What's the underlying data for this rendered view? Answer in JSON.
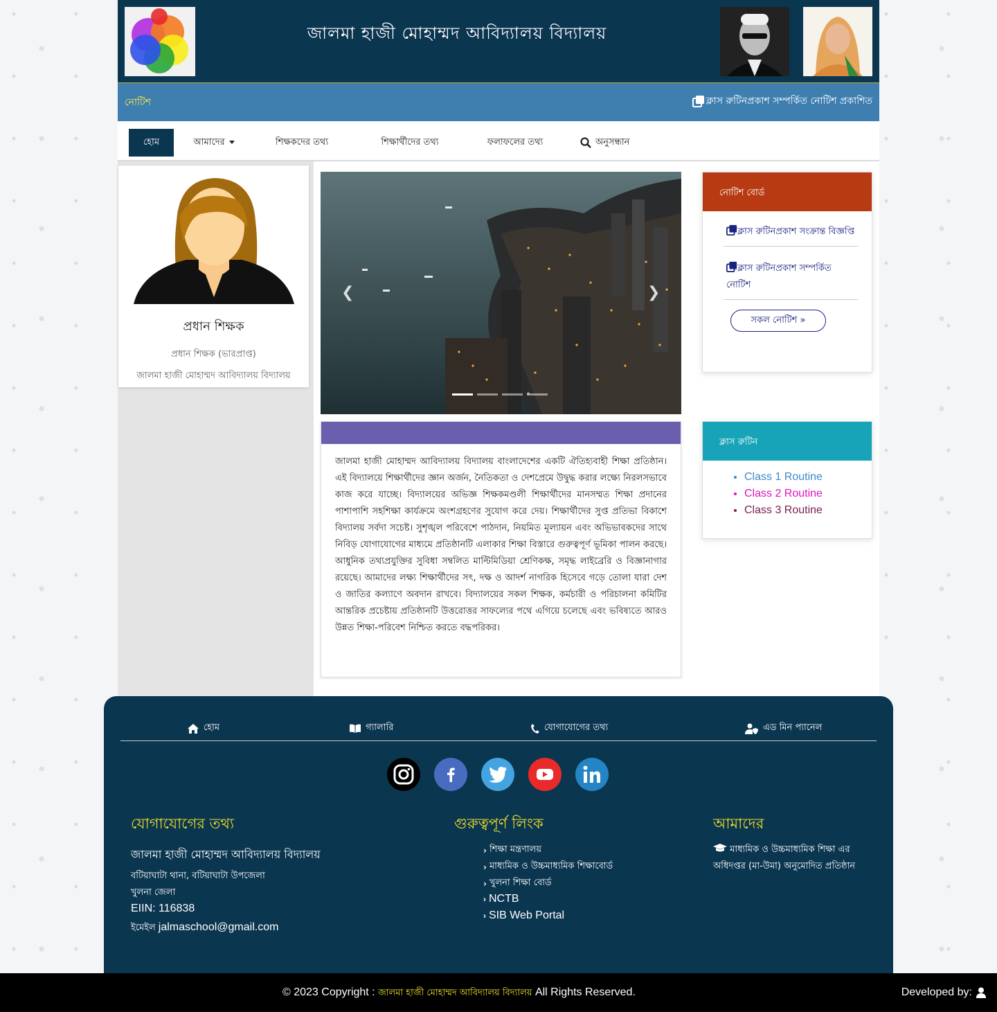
{
  "header": {
    "title": "জালমা হাজী মোহাম্মদ আবিদ্যালয় বিদ্যালয়"
  },
  "notice_bar": {
    "label": "নোটিশ",
    "ticker": "ক্লাস রুটিনপ্রকাশ সম্পর্কিত নোটিশ প্রকাশিত"
  },
  "nav": {
    "home": "হোম",
    "about": "আমাদের",
    "teachers": "শিক্ষকদের তথ্য",
    "students": "শিক্ষার্থীদের তথ্য",
    "result": "ফলাফলের তথ্য",
    "search": "অনুসন্ধান"
  },
  "profile": {
    "name": "প্রধান শিক্ষক",
    "role": "প্রধান শিক্ষক (ভারপ্রাপ্ত)",
    "school": "জালমা হাজী মোহাম্মদ আবিদ্যালয় বিদ্যালয়"
  },
  "about": {
    "text": "জালমা হাজী মোহাম্মদ আবিদ্যালয় বিদ্যালয় বাংলাদেশের একটি ঐতিহ্যবাহী শিক্ষা প্রতিষ্ঠান। এই বিদ্যালয়ে শিক্ষার্থীদের জ্ঞান অর্জন, নৈতিকতা ও দেশপ্রেমে উদ্বুদ্ধ করার লক্ষ্যে নিরলসভাবে কাজ করে যাচ্ছে। বিদ্যালয়ের অভিজ্ঞ শিক্ষকমণ্ডলী শিক্ষার্থীদের মানসম্মত শিক্ষা প্রদানের পাশাপাশি সহশিক্ষা কার্যক্রমে অংশগ্রহণের সুযোগ করে দেয়। শিক্ষার্থীদের সুপ্ত প্রতিভা বিকাশে বিদ্যালয় সর্বদা সচেষ্ট। সুশৃঙ্খল পরিবেশে পাঠদান, নিয়মিত মূল্যায়ন এবং অভিভাবকদের সাথে নিবিড় যোগাযোগের মাধ্যমে প্রতিষ্ঠানটি এলাকার শিক্ষা বিস্তারে গুরুত্বপূর্ণ ভূমিকা পালন করছে। আধুনিক তথ্যপ্রযুক্তির সুবিধা সম্বলিত মাল্টিমিডিয়া শ্রেণিকক্ষ, সমৃদ্ধ লাইব্রেরি ও বিজ্ঞানাগার রয়েছে। আমাদের লক্ষ্য শিক্ষার্থীদের সৎ, দক্ষ ও আদর্শ নাগরিক হিসেবে গড়ে তোলা যারা দেশ ও জাতির কল্যাণে অবদান রাখবে। বিদ্যালয়ের সকল শিক্ষক, কর্মচারী ও পরিচালনা কমিটির আন্তরিক প্রচেষ্টায় প্রতিষ্ঠানটি উত্তরোত্তর সাফল্যের পথে এগিয়ে চলেছে এবং ভবিষ্যতে আরও উন্নত শিক্ষা-পরিবেশ নিশ্চিত করতে বদ্ধপরিকর।"
  },
  "notice_card": {
    "title": "নোটিশ বোর্ড",
    "items": [
      "ক্লাস রুটিনপ্রকাশ সংক্রান্ত বিজ্ঞপ্তি",
      "ক্লাস রুটিনপ্রকাশ সম্পর্কিত নোটিশ"
    ],
    "all_button": "সকল নোটিশ »"
  },
  "routine_card": {
    "title": "ক্লাস রুটিন",
    "items": [
      "Class 1 Routine",
      "Class 2 Routine",
      "Class 3 Routine"
    ],
    "colors": [
      "#3f88c5",
      "#e012c0",
      "#7b1c4e"
    ]
  },
  "footer": {
    "links": {
      "home": "হোম",
      "gallery": "গ্যালারি",
      "contact": "যোগাযোগের তথ্য",
      "admin": "এড মিন প্যানেল"
    },
    "contact": {
      "heading": "যোগাযোগের তথ্য",
      "school": "জালমা হাজী মোহাম্মদ আবিদ্যালয় বিদ্যালয়",
      "address": "বটিয়াঘাটা থানা, বটিয়াঘাটা উপজেলা",
      "district": "খুলনা জেলা",
      "eiin": "EIIN: 116838",
      "email_label": "ইমেইল",
      "email": "jalmaschool@gmail.com"
    },
    "quick": {
      "heading": "গুরুত্বপূর্ণ লিংক",
      "items": [
        "শিক্ষা মন্ত্রণালয়",
        "মাধ্যমিক ও উচ্চমাধ্যমিক শিক্ষাবোর্ড",
        "খুলনা শিক্ষা বোর্ড",
        "NCTB",
        "SIB Web Portal"
      ]
    },
    "about": {
      "heading": "আমাদের",
      "text": "মাধ্যমিক ও উচ্চমাধ্যমিক শিক্ষা এর অধিদপ্তর (মা-উমা) অনুমোদিত প্রতিষ্ঠান"
    }
  },
  "copyright": {
    "prefix": "© 2023 Copyright :",
    "school": "জালমা হাজী মোহাম্মদ আবিদ্যালয় বিদ্যালয়",
    "suffix": "All Rights Reserved.",
    "developed": "Developed by:"
  }
}
